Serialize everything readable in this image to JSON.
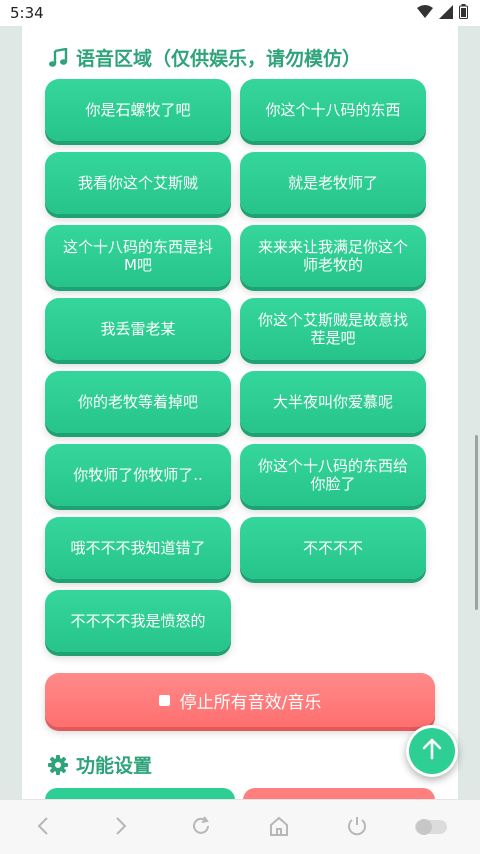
{
  "status": {
    "time": "5:34"
  },
  "voice_section": {
    "title": "语音区域（仅供娱乐，请勿模仿）"
  },
  "voice_buttons": [
    "你是石螺牧了吧",
    "你这个十八码的东西",
    "我看你这个艾斯贼",
    "就是老牧师了",
    "这个十八码的东西是抖M吧",
    "来来来让我满足你这个师老牧的",
    "我丢雷老某",
    "你这个艾斯贼是故意找茬是吧",
    "你的老牧等着掉吧",
    "大半夜叫你爱慕呢",
    "你牧师了你牧师了..",
    "你这个十八码的东西给你脸了",
    "哦不不不我知道错了",
    "不不不不",
    "不不不不我是愤怒的"
  ],
  "stop_button": {
    "label": "停止所有音效/音乐"
  },
  "settings_section": {
    "title": "功能设置"
  },
  "colors": {
    "accent": "#2fa37a",
    "button_green": "#2ecf94",
    "stop_red": "#ff7474"
  }
}
